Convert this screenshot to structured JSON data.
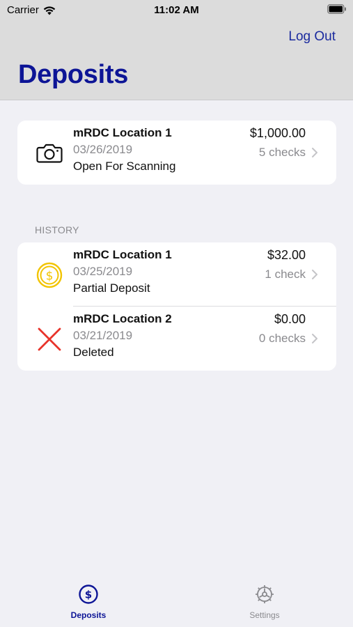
{
  "status_bar": {
    "carrier": "Carrier",
    "time": "11:02 AM"
  },
  "nav": {
    "logout_label": "Log Out",
    "title": "Deposits"
  },
  "current": {
    "name": "mRDC Location 1",
    "date": "03/26/2019",
    "status": "Open For Scanning",
    "amount": "$1,000.00",
    "checks": "5 checks",
    "icon": "camera-icon"
  },
  "history": {
    "section_label": "HISTORY",
    "items": [
      {
        "name": "mRDC Location 1",
        "date": "03/25/2019",
        "status": "Partial Deposit",
        "amount": "$32.00",
        "checks": "1 check",
        "icon": "dollar-coin-icon"
      },
      {
        "name": "mRDC Location 2",
        "date": "03/21/2019",
        "status": "Deleted",
        "amount": "$0.00",
        "checks": "0 checks",
        "icon": "deleted-x-icon"
      }
    ]
  },
  "tabbar": {
    "deposits_label": "Deposits",
    "settings_label": "Settings"
  },
  "colors": {
    "accent": "#0d1596",
    "coin": "#f2c400",
    "delete": "#e8332a",
    "header_bg": "#dcdcdc",
    "page_bg": "#f0f0f5"
  }
}
